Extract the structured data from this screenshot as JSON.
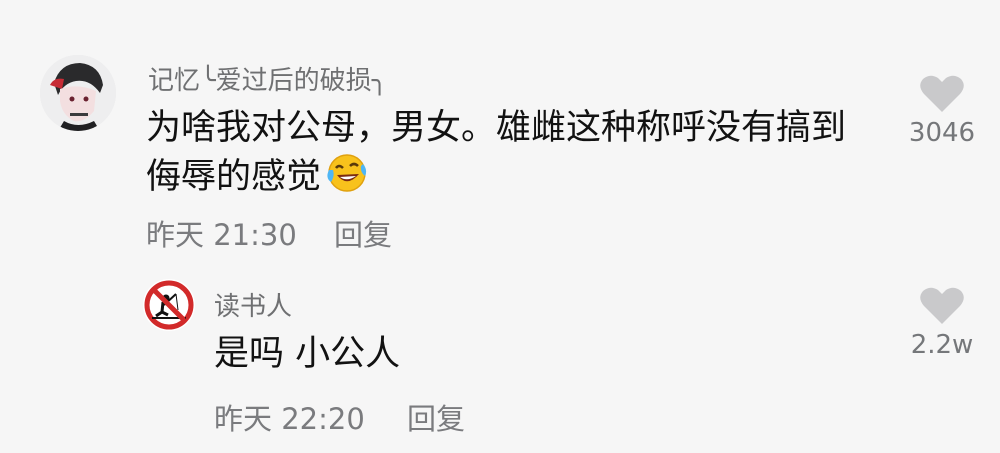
{
  "comment": {
    "username": "记忆╰爱过后的破损╮",
    "text": "为啥我对公母，男女。雄雌这种称呼没有搞到",
    "text_line2": "侮辱的感觉",
    "emoji_icon": "laughing-tears-emoji",
    "time": "昨天 21:30",
    "reply_label": "回复",
    "likes": "3046"
  },
  "reply": {
    "username": "读书人",
    "text": "是吗 小公人",
    "time": "昨天 22:20",
    "reply_label": "回复",
    "likes": "2.2w"
  },
  "colors": {
    "background": "#f6f6f6",
    "text": "#121212",
    "muted": "#7a7b7e",
    "heart": "#c9c9cb"
  }
}
